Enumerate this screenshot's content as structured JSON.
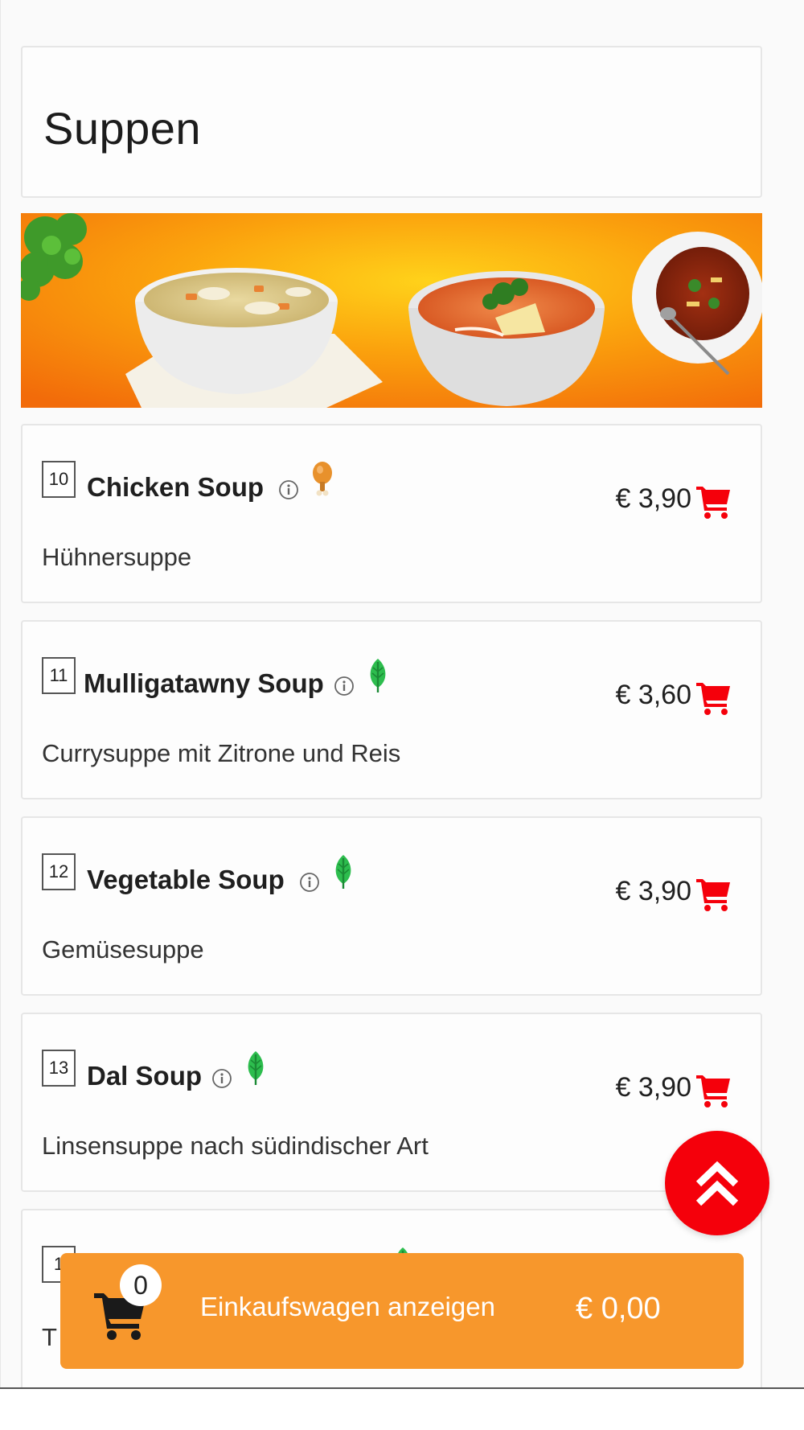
{
  "section": {
    "title": "Suppen"
  },
  "items": [
    {
      "number": "10",
      "name": "Chicken Soup",
      "badge": "chicken-leg-icon",
      "description": "Hühnersuppe",
      "price": "€ 3,90"
    },
    {
      "number": "11",
      "name": "Mulligatawny Soup",
      "badge": "vegetarian-leaf-icon",
      "description": "Currysuppe mit Zitrone und Reis",
      "price": "€ 3,60"
    },
    {
      "number": "12",
      "name": "Vegetable Soup",
      "badge": "vegetarian-leaf-icon",
      "description": "Gemüsesuppe",
      "price": "€ 3,90"
    },
    {
      "number": "13",
      "name": "Dal Soup",
      "badge": "vegetarian-leaf-icon",
      "description": "Linsensuppe nach südindischer Art",
      "price": "€ 3,90"
    },
    {
      "number": "1",
      "name": "",
      "badge": "vegetarian-leaf-icon",
      "description": "T",
      "price": ""
    }
  ],
  "cart": {
    "count": "0",
    "label": "Einkaufswagen anzeigen",
    "total": "€ 0,00"
  },
  "colors": {
    "accent_red": "#f5000b",
    "cart_orange": "#f7972c",
    "leaf_green": "#2dbd4e",
    "chicken_orange": "#e8912c"
  }
}
